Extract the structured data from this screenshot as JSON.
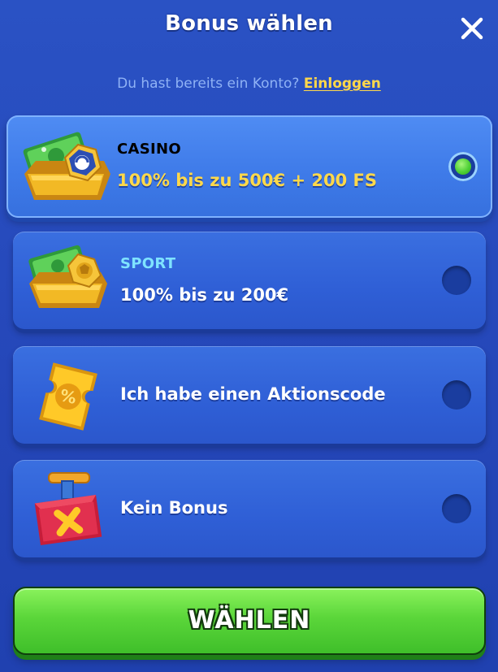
{
  "header": {
    "title": "Bonus wählen",
    "close_icon": "close-icon"
  },
  "login": {
    "prompt": "Du hast bereits ein Konto?",
    "link": "Einloggen"
  },
  "options": [
    {
      "id": "casino",
      "kicker": "CASINO",
      "text": "100% bis zu 500€ + 200 FS",
      "selected": true,
      "icon": "casino-bonus-icon",
      "kicker_color": "#ffffff",
      "text_color": "#ffd84a"
    },
    {
      "id": "sport",
      "kicker": "SPORT",
      "text": "100% bis zu 200€",
      "selected": false,
      "icon": "sport-bonus-icon",
      "kicker_color": "#7fe3ff",
      "text_color": "#ffffff"
    },
    {
      "id": "promo",
      "kicker": "",
      "text": "Ich habe einen Aktionscode",
      "selected": false,
      "icon": "promo-code-ticket-icon",
      "text_color": "#ffffff"
    },
    {
      "id": "none",
      "kicker": "",
      "text": "Kein Bonus",
      "selected": false,
      "icon": "no-bonus-box-icon",
      "text_color": "#ffffff"
    }
  ],
  "cta": {
    "label": "WÄHLEN"
  },
  "colors": {
    "background": "#2547b9",
    "card": "#2f5fd6",
    "card_selected": "#3f7be9",
    "accent_yellow": "#ffd84a",
    "cta_green": "#5bd63a"
  }
}
